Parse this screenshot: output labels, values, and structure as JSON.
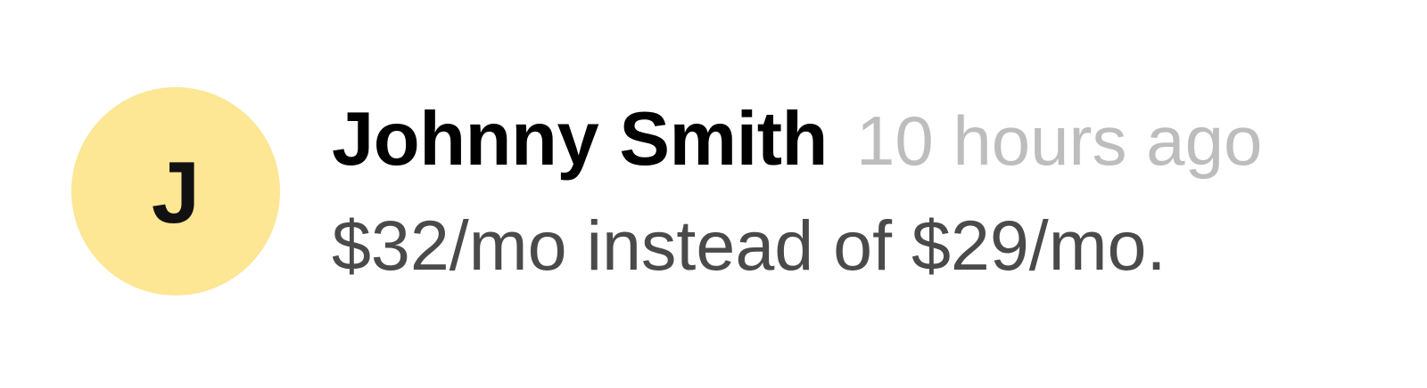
{
  "comment": {
    "avatar": {
      "initial": "J",
      "color": "#fde694"
    },
    "author": "Johnny Smith",
    "timestamp": "10 hours ago",
    "message": "$32/mo instead of $29/mo."
  },
  "colors": {
    "author": "#000000",
    "timestamp": "#bdbdbd",
    "message": "#4a4a4a"
  }
}
